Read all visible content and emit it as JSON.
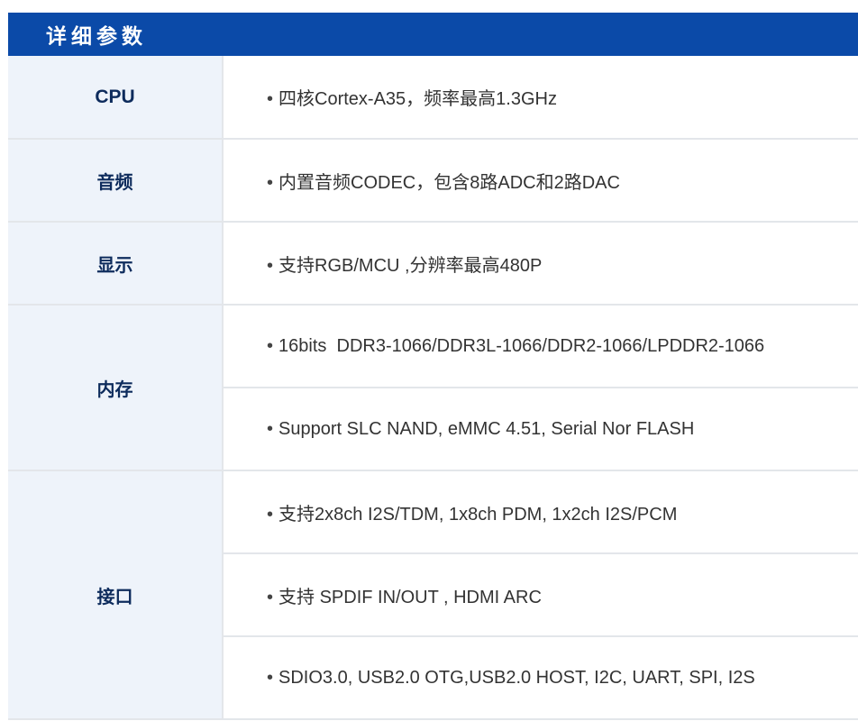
{
  "header": {
    "title": "详细参数"
  },
  "colors": {
    "header_bg": "#0b4aa8",
    "label_bg": "#eef3fa",
    "label_text": "#0d2b5c",
    "border": "#e3e6ea",
    "value_text": "#333333"
  },
  "bullet_symbol": "•",
  "specs": [
    {
      "label": "CPU",
      "values": [
        "四核Cortex-A35，频率最高1.3GHz"
      ]
    },
    {
      "label": "音频",
      "values": [
        "内置音频CODEC，包含8路ADC和2路DAC"
      ]
    },
    {
      "label": "显示",
      "values": [
        "支持RGB/MCU ,分辨率最高480P"
      ]
    },
    {
      "label": "内存",
      "values": [
        "16bits  DDR3-1066/DDR3L-1066/DDR2-1066/LPDDR2-1066",
        "Support SLC NAND, eMMC 4.51, Serial Nor FLASH"
      ]
    },
    {
      "label": "接口",
      "values": [
        "支持2x8ch I2S/TDM, 1x8ch PDM, 1x2ch I2S/PCM",
        "支持 SPDIF IN/OUT , HDMI ARC",
        "SDIO3.0, USB2.0 OTG,USB2.0 HOST, I2C, UART, SPI, I2S"
      ]
    }
  ]
}
